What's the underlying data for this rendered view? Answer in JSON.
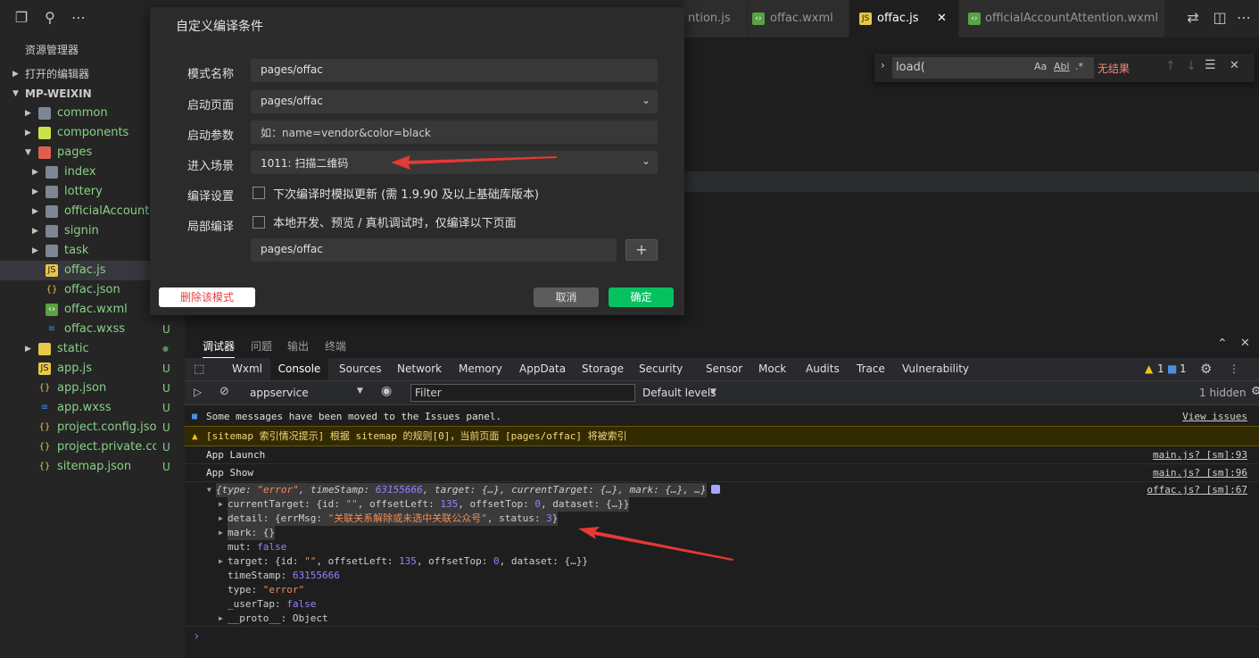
{
  "sidebar": {
    "title": "资源管理器",
    "sections": [
      {
        "label": "打开的编辑器",
        "expanded": false
      },
      {
        "label": "MP-WEIXIN",
        "expanded": true
      }
    ],
    "tree": [
      {
        "name": "common",
        "type": "folder",
        "depth": 1,
        "color": "#89d185"
      },
      {
        "name": "components",
        "type": "folder",
        "depth": 1,
        "color": "#89d185"
      },
      {
        "name": "pages",
        "type": "folder-open",
        "depth": 1,
        "color": "#89d185"
      },
      {
        "name": "index",
        "type": "folder",
        "depth": 2,
        "color": "#89d185"
      },
      {
        "name": "lottery",
        "type": "folder",
        "depth": 2,
        "color": "#89d185"
      },
      {
        "name": "officialAccount...",
        "type": "folder",
        "depth": 2,
        "color": "#89d185"
      },
      {
        "name": "signin",
        "type": "folder",
        "depth": 2,
        "color": "#89d185"
      },
      {
        "name": "task",
        "type": "folder",
        "depth": 2,
        "color": "#89d185"
      },
      {
        "name": "offac.js",
        "type": "js",
        "depth": 2,
        "color": "#89d185"
      },
      {
        "name": "offac.json",
        "type": "json",
        "depth": 2,
        "color": "#89d185"
      },
      {
        "name": "offac.wxml",
        "type": "wxml",
        "depth": 2,
        "color": "#89d185"
      },
      {
        "name": "offac.wxss",
        "type": "wxss",
        "depth": 2,
        "color": "#89d185",
        "badge": "U"
      },
      {
        "name": "static",
        "type": "folder",
        "depth": 1,
        "color": "#89d185",
        "badge": "●"
      },
      {
        "name": "app.js",
        "type": "js",
        "depth": 1,
        "color": "#89d185",
        "badge": "U"
      },
      {
        "name": "app.json",
        "type": "json",
        "depth": 1,
        "color": "#89d185",
        "badge": "U"
      },
      {
        "name": "app.wxss",
        "type": "wxss",
        "depth": 1,
        "color": "#89d185",
        "badge": "U"
      },
      {
        "name": "project.config.json",
        "type": "json",
        "depth": 1,
        "color": "#89d185",
        "badge": "U"
      },
      {
        "name": "project.private.co...",
        "type": "json",
        "depth": 1,
        "color": "#89d185",
        "badge": "U"
      },
      {
        "name": "sitemap.json",
        "type": "json",
        "depth": 1,
        "color": "#89d185",
        "badge": "U"
      }
    ]
  },
  "tabs": [
    {
      "label": "ntion.js",
      "type": "none"
    },
    {
      "label": "offac.wxml",
      "type": "wxml"
    },
    {
      "label": "offac.js",
      "type": "js",
      "active": true,
      "close": "✕"
    },
    {
      "label": "officialAccountAttention.wxml",
      "type": "wxml"
    }
  ],
  "find": {
    "value": "load(",
    "case": "Aa",
    "word": "Abl",
    "regex": ".*",
    "result": "无结果"
  },
  "modal": {
    "title": "自定义编译条件",
    "mode_label": "模式名称",
    "mode_value": "pages/offac",
    "start_label": "启动页面",
    "start_value": "pages/offac",
    "params_label": "启动参数",
    "params_placeholder": "如：name=vendor&color=black",
    "scene_label": "进入场景",
    "scene_value": "1011: 扫描二维码",
    "compile_label": "编译设置",
    "compile_option": "下次编译时模拟更新 (需 1.9.90 及以上基础库版本)",
    "partial_label": "局部编译",
    "partial_option": "本地开发、预览 / 真机调试时，仅编译以下页面",
    "partial_value": "pages/offac",
    "delete_btn": "删除该模式",
    "cancel_btn": "取消",
    "ok_btn": "确定"
  },
  "panel": {
    "tabs": [
      "调试器",
      "问题",
      "输出",
      "终端"
    ],
    "devtools_tabs": [
      "Wxml",
      "Console",
      "Sources",
      "Network",
      "Memory",
      "AppData",
      "Storage",
      "Security",
      "Sensor",
      "Mock",
      "Audits",
      "Trace",
      "Vulnerability"
    ],
    "warn_count": "1",
    "info_count": "1",
    "context": "appservice",
    "filter_placeholder": "Filter",
    "levels": "Default levels",
    "hidden": "1 hidden"
  },
  "console": {
    "info_msg": "Some messages have been moved to the Issues panel.",
    "info_link": "View issues",
    "warn_msg": "[sitemap 索引情况提示] 根据 sitemap 的规则[0]，当前页面 [pages/offac] 将被索引",
    "launch": "App Launch",
    "launch_src": "main.js? [sm]:93",
    "show": "App Show",
    "show_src": "main.js? [sm]:96",
    "obj_src": "offac.js? [sm]:67",
    "obj": {
      "summary_head": "{type: ",
      "summary_type": "\"error\"",
      "summary_mid": ", timeStamp: ",
      "summary_ts": "63155666",
      "summary_tail": ", target: {…}, currentTarget: {…}, mark: {…}, …}",
      "ct_head": "currentTarget: {id: ",
      "ct_id": "\"\"",
      "ct_mid": ", offsetLeft: ",
      "ct_left": "135",
      "ct_mid2": ", offsetTop: ",
      "ct_top": "0",
      "ct_tail": ", dataset: {…}}",
      "detail_head": "detail: {errMsg: ",
      "detail_msg": "\"关联关系解除或未选中关联公众号\"",
      "detail_mid": ", status: ",
      "detail_status": "3",
      "detail_tail": "}",
      "mark": "mark: {}",
      "mut_key": "mut: ",
      "mut_val": "false",
      "tg_head": "target: {id: ",
      "tg_id": "\"\"",
      "tg_mid": ", offsetLeft: ",
      "tg_left": "135",
      "tg_mid2": ", offsetTop: ",
      "tg_top": "0",
      "tg_tail": ", dataset: {…}}",
      "ts_key": "timeStamp: ",
      "ts_val": "63155666",
      "type_key": "type: ",
      "type_val": "\"error\"",
      "ut_key": "_userTap: ",
      "ut_val": "false",
      "proto": "__proto__: Object"
    },
    "prompt": "›"
  },
  "colors": {
    "accent_green": "#07c160",
    "warn_bg": "#332b00",
    "error_text": "#f48771",
    "annotation_red": "#e53935"
  }
}
